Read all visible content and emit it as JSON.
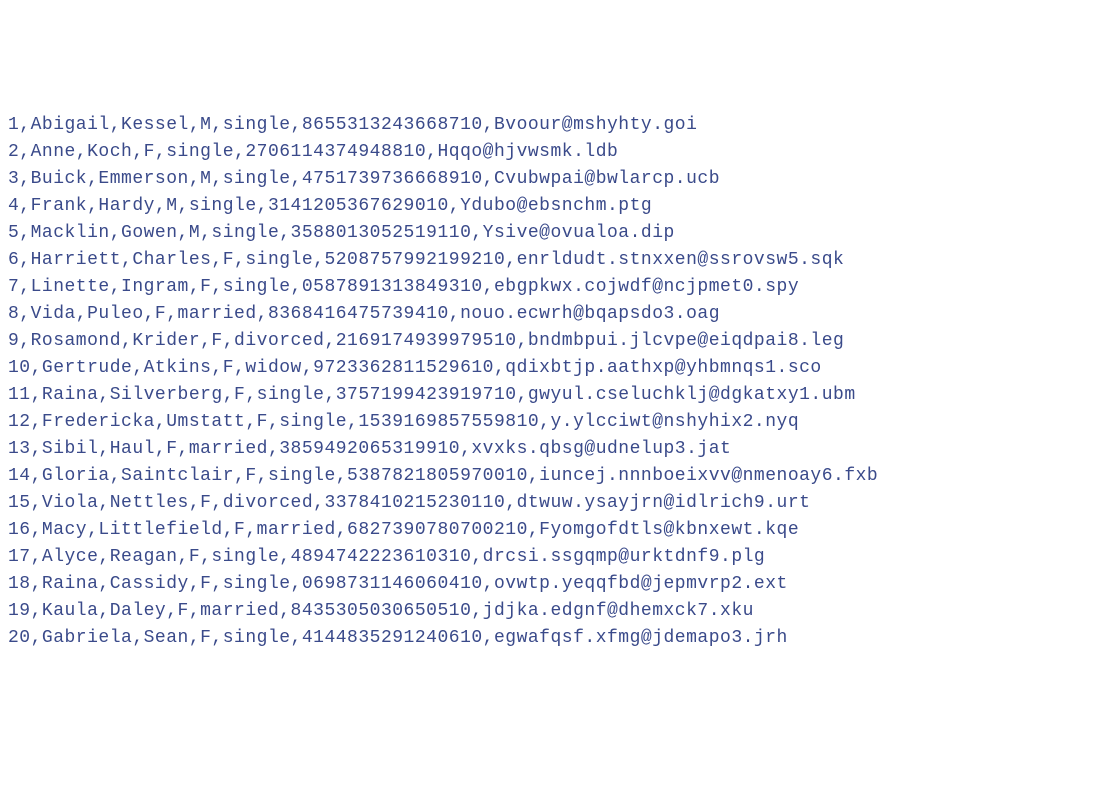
{
  "records": [
    {
      "id": "1",
      "first": "Abigail",
      "last": "Kessel",
      "sex": "M",
      "status": "single",
      "number": "8655313243668710",
      "email": "Bvoour@mshyhty.goi"
    },
    {
      "id": "2",
      "first": "Anne",
      "last": "Koch",
      "sex": "F",
      "status": "single",
      "number": "2706114374948810",
      "email": "Hqqo@hjvwsmk.ldb"
    },
    {
      "id": "3",
      "first": "Buick",
      "last": "Emmerson",
      "sex": "M",
      "status": "single",
      "number": "4751739736668910",
      "email": "Cvubwpai@bwlarcp.ucb"
    },
    {
      "id": "4",
      "first": "Frank",
      "last": "Hardy",
      "sex": "M",
      "status": "single",
      "number": "3141205367629010",
      "email": "Ydubo@ebsnchm.ptg"
    },
    {
      "id": "5",
      "first": "Macklin",
      "last": "Gowen",
      "sex": "M",
      "status": "single",
      "number": "3588013052519110",
      "email": "Ysive@ovualoa.dip"
    },
    {
      "id": "6",
      "first": "Harriett",
      "last": "Charles",
      "sex": "F",
      "status": "single",
      "number": "5208757992199210",
      "email": "enrldudt.stnxxen@ssrovsw5.sqk"
    },
    {
      "id": "7",
      "first": "Linette",
      "last": "Ingram",
      "sex": "F",
      "status": "single",
      "number": "0587891313849310",
      "email": "ebgpkwx.cojwdf@ncjpmet0.spy"
    },
    {
      "id": "8",
      "first": "Vida",
      "last": "Puleo",
      "sex": "F",
      "status": "married",
      "number": "8368416475739410",
      "email": "nouo.ecwrh@bqapsdo3.oag"
    },
    {
      "id": "9",
      "first": "Rosamond",
      "last": "Krider",
      "sex": "F",
      "status": "divorced",
      "number": "2169174939979510",
      "email": "bndmbpui.jlcvpe@eiqdpai8.leg"
    },
    {
      "id": "10",
      "first": "Gertrude",
      "last": "Atkins",
      "sex": "F",
      "status": "widow",
      "number": "9723362811529610",
      "email": "qdixbtjp.aathxp@yhbmnqs1.sco"
    },
    {
      "id": "11",
      "first": "Raina",
      "last": "Silverberg",
      "sex": "F",
      "status": "single",
      "number": "3757199423919710",
      "email": "gwyul.cseluchklj@dgkatxy1.ubm"
    },
    {
      "id": "12",
      "first": "Fredericka",
      "last": "Umstatt",
      "sex": "F",
      "status": "single",
      "number": "1539169857559810",
      "email": "y.ylcciwt@nshyhix2.nyq"
    },
    {
      "id": "13",
      "first": "Sibil",
      "last": "Haul",
      "sex": "F",
      "status": "married",
      "number": "3859492065319910",
      "email": "xvxks.qbsg@udnelup3.jat"
    },
    {
      "id": "14",
      "first": "Gloria",
      "last": "Saintclair",
      "sex": "F",
      "status": "single",
      "number": "5387821805970010",
      "email": "iuncej.nnnboeixvv@nmenoay6.fxb"
    },
    {
      "id": "15",
      "first": "Viola",
      "last": "Nettles",
      "sex": "F",
      "status": "divorced",
      "number": "3378410215230110",
      "email": "dtwuw.ysayjrn@idlrich9.urt"
    },
    {
      "id": "16",
      "first": "Macy",
      "last": "Littlefield",
      "sex": "F",
      "status": "married",
      "number": "6827390780700210",
      "email": "Fyomgofdtls@kbnxewt.kqe"
    },
    {
      "id": "17",
      "first": "Alyce",
      "last": "Reagan",
      "sex": "F",
      "status": "single",
      "number": "4894742223610310",
      "email": "drcsi.ssgqmp@urktdnf9.plg"
    },
    {
      "id": "18",
      "first": "Raina",
      "last": "Cassidy",
      "sex": "F",
      "status": "single",
      "number": "0698731146060410",
      "email": "ovwtp.yeqqfbd@jepmvrp2.ext"
    },
    {
      "id": "19",
      "first": "Kaula",
      "last": "Daley",
      "sex": "F",
      "status": "married",
      "number": "8435305030650510",
      "email": "jdjka.edgnf@dhemxck7.xku"
    },
    {
      "id": "20",
      "first": "Gabriela",
      "last": "Sean",
      "sex": "F",
      "status": "single",
      "number": "4144835291240610",
      "email": "egwafqsf.xfmg@jdemapo3.jrh"
    }
  ]
}
